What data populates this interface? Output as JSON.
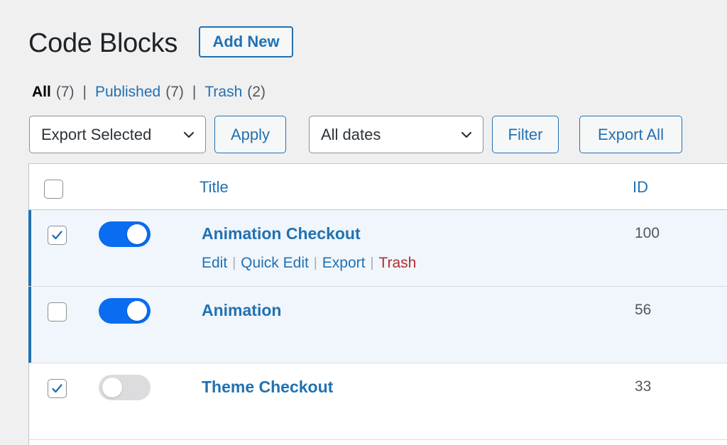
{
  "header": {
    "title": "Code Blocks",
    "add_new_label": "Add New"
  },
  "views": [
    {
      "label": "All",
      "count": "(7)",
      "current": true
    },
    {
      "label": "Published",
      "count": "(7)",
      "current": false
    },
    {
      "label": "Trash",
      "count": "(2)",
      "current": false
    }
  ],
  "views_separator": "|",
  "toolbar": {
    "bulk_action_selected": "Export Selected",
    "apply_label": "Apply",
    "date_filter_selected": "All dates",
    "filter_label": "Filter",
    "export_all_label": "Export All"
  },
  "table": {
    "columns": {
      "title": "Title",
      "id": "ID"
    },
    "rows": [
      {
        "checked": true,
        "active": true,
        "title": "Animation Checkout",
        "id": "100",
        "enabled": true,
        "actions": {
          "edit": "Edit",
          "quick_edit": "Quick Edit",
          "export": "Export",
          "trash": "Trash"
        }
      },
      {
        "checked": false,
        "active": true,
        "title": "Animation",
        "id": "56",
        "enabled": true
      },
      {
        "checked": true,
        "active": false,
        "title": "Theme Checkout",
        "id": "33",
        "enabled": false
      }
    ],
    "actions_separator": "|"
  },
  "colors": {
    "link": "#2271b1",
    "toggle_on": "#0a6cf0",
    "toggle_off": "#dcdcde",
    "trash": "#b32d2e",
    "active_row_bg": "#f0f6fc"
  },
  "icons": {
    "select_arrow": "chevron-down-icon",
    "checkbox_mark": "checkmark-icon"
  }
}
